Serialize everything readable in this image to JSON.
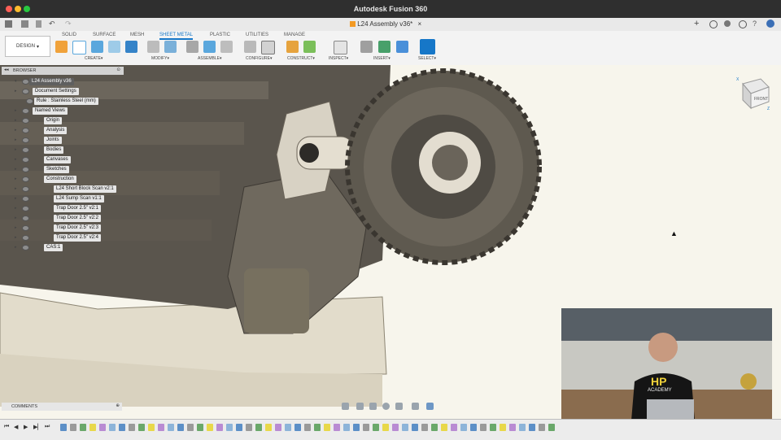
{
  "window": {
    "title": "Autodesk Fusion 360"
  },
  "document_tab": {
    "label": "L24 Assembly v36*"
  },
  "workspace_tabs": [
    "SOLID",
    "SURFACE",
    "MESH",
    "SHEET METAL",
    "PLASTIC",
    "UTILITIES",
    "MANAGE"
  ],
  "active_tab": "SHEET METAL",
  "design_button": "DESIGN",
  "ribbon_groups": [
    "CREATE",
    "MODIFY",
    "ASSEMBLE",
    "CONFIGURE",
    "CONSTRUCT",
    "INSPECT",
    "INSERT",
    "SELECT"
  ],
  "browser": {
    "title": "BROWSER",
    "root": "L24 Assembly v36",
    "items": [
      "Document Settings",
      "Rule : Stainless Steel (mm)",
      "Named Views",
      "Origin",
      "Analysis",
      "Joints",
      "Bodies",
      "Canvases",
      "Sketches",
      "Construction",
      "L24 Short Block Scan v2:1",
      "L24 Sump Scan v1:1",
      "Trap Door 2.5\" v2:1",
      "Trap Door 2.5\" v2:2",
      "Trap Door 2.5\" v2:3",
      "Trap Door 2.5\" v2:4",
      "CAS:1"
    ]
  },
  "comments": {
    "title": "COMMENTS"
  },
  "view_cube": {
    "face": "FRONT",
    "axes": [
      "X",
      "Y",
      "Z"
    ]
  },
  "webcam": {
    "shirt_text": [
      "HP",
      "ACADEMY"
    ]
  },
  "colors": {
    "accent": "#1677c8",
    "viewport_bg": "#f7f5ec",
    "model": "#6b6459",
    "timeline_highlight": "#e8d84a"
  }
}
